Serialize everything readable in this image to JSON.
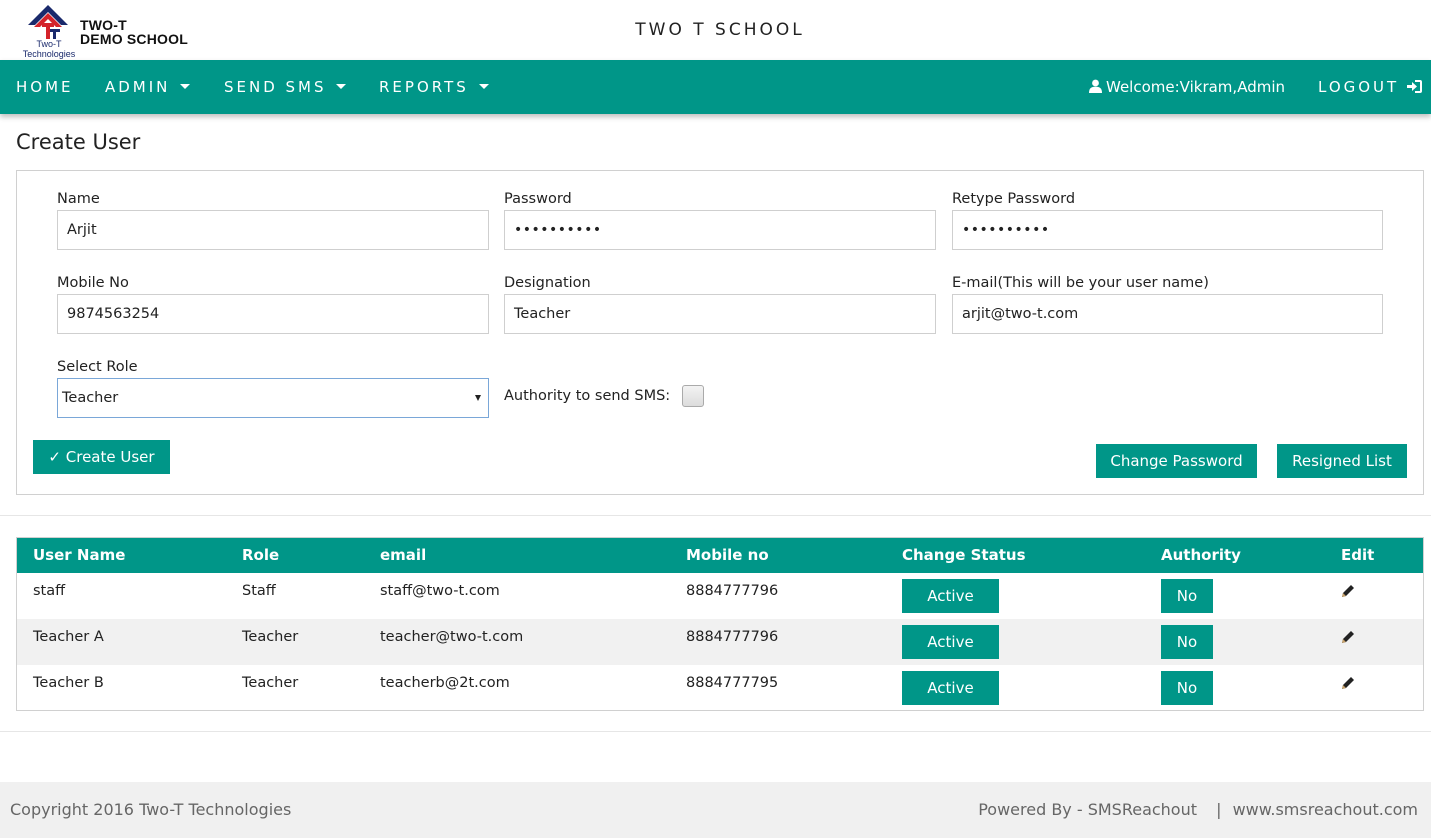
{
  "header": {
    "logo_caption_line1": "Two-T",
    "logo_caption_line2": "Technologies",
    "school_short_line1": "TWO-T",
    "school_short_line2": "DEMO SCHOOL",
    "site_title": "TWO T SCHOOL"
  },
  "nav": {
    "items": [
      {
        "label": "HOME",
        "icon": null
      },
      {
        "label": "ADMIN",
        "icon": "caret-down-icon"
      },
      {
        "label": "SEND SMS",
        "icon": "caret-down-icon"
      },
      {
        "label": "REPORTS",
        "icon": "caret-down-icon"
      }
    ],
    "welcome_text": "Welcome:Vikram,Admin",
    "welcome_icon": "user-icon",
    "logout_label": "LOGOUT",
    "logout_icon": "sign-in-icon"
  },
  "page": {
    "title": "Create User"
  },
  "form": {
    "name": {
      "label": "Name",
      "value": "Arjit"
    },
    "password": {
      "label": "Password",
      "value": "••••••••••"
    },
    "retype_password": {
      "label": "Retype Password",
      "value": "••••••••••"
    },
    "mobile": {
      "label": "Mobile No",
      "value": "9874563254"
    },
    "designation": {
      "label": "Designation",
      "value": "Teacher"
    },
    "email": {
      "label": "E-mail(This will be your user name)",
      "value": "arjit@two-t.com"
    },
    "role": {
      "label": "Select Role",
      "selected": "Teacher"
    },
    "sms_authority": {
      "label": "Authority to send SMS:",
      "checked": false
    },
    "create_button": "✓ Create User",
    "change_password_button": "Change Password",
    "resigned_list_button": "Resigned List"
  },
  "table": {
    "columns": [
      "User Name",
      "Role",
      "email",
      "Mobile no",
      "Change Status",
      "Authority",
      "Edit"
    ],
    "rows": [
      {
        "user_name": "staff",
        "role": "Staff",
        "email": "staff@two-t.com",
        "mobile": "8884777796",
        "status": "Active",
        "authority": "No",
        "edit_icon": "pencil-icon"
      },
      {
        "user_name": "Teacher A",
        "role": "Teacher",
        "email": "teacher@two-t.com",
        "mobile": "8884777796",
        "status": "Active",
        "authority": "No",
        "edit_icon": "pencil-icon"
      },
      {
        "user_name": "Teacher B",
        "role": "Teacher",
        "email": "teacherb@2t.com",
        "mobile": "8884777795",
        "status": "Active",
        "authority": "No",
        "edit_icon": "pencil-icon"
      }
    ]
  },
  "footer": {
    "copyright": "Copyright 2016  Two-T Technologies",
    "powered_by": "Powered By - SMSReachout",
    "separator": "|",
    "website": "www.smsreachout.com"
  },
  "colors": {
    "primary": "#009688",
    "footer_bg": "#f0f0f0",
    "row_alt": "#f1f1f1"
  }
}
